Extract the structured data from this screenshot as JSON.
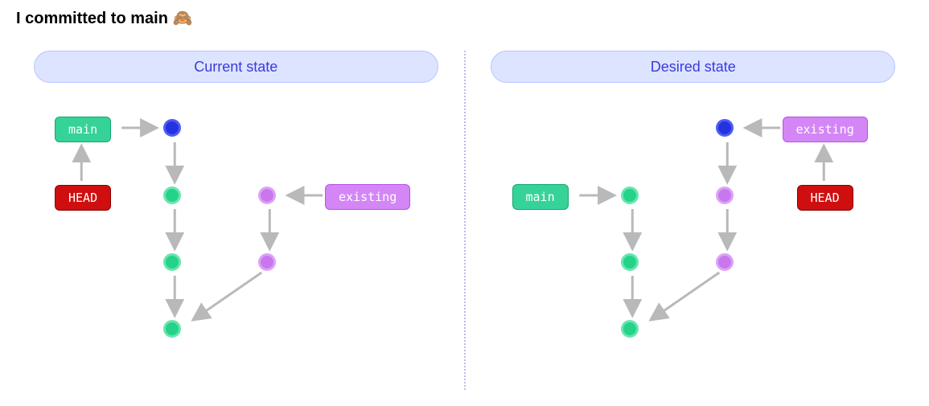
{
  "title": "I committed to main 🙈",
  "left": {
    "header": "Current state",
    "labels": {
      "main": "main",
      "head": "HEAD",
      "existing": "existing"
    }
  },
  "right": {
    "header": "Desired state",
    "labels": {
      "main": "main",
      "head": "HEAD",
      "existing": "existing"
    }
  },
  "colors": {
    "arrow": "#b9b9b9",
    "headerBg": "#dde4ff",
    "headerText": "#3a3bdc"
  }
}
